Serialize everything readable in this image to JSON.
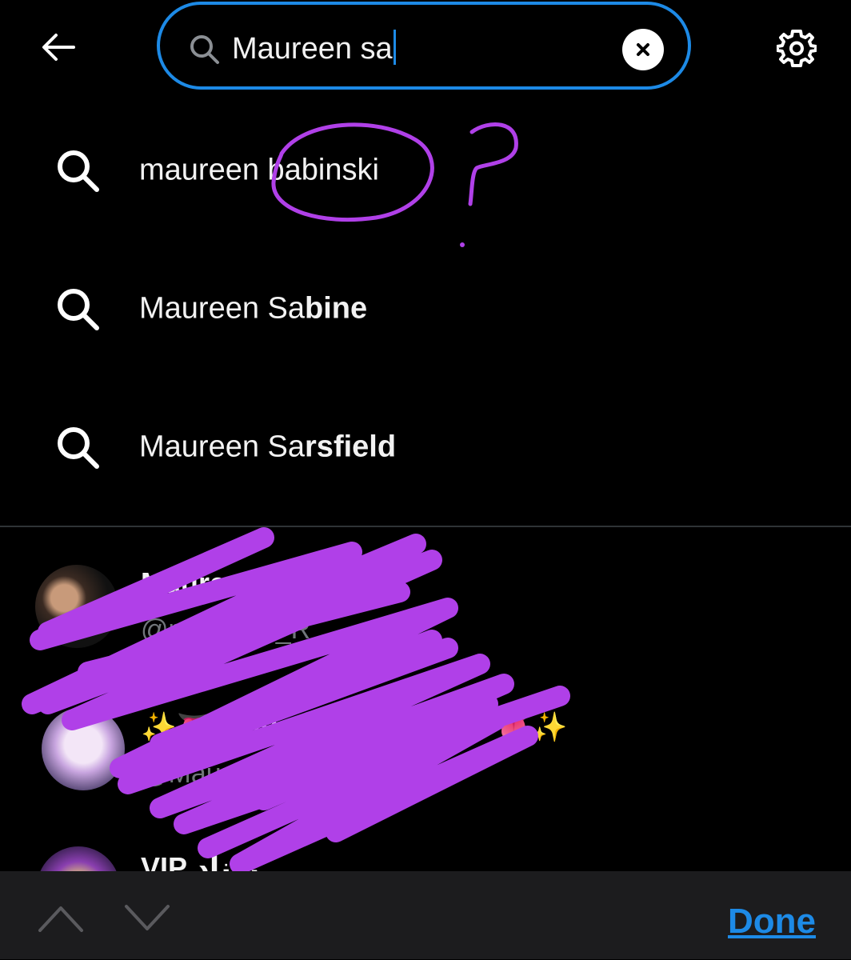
{
  "search": {
    "query": "Maureen sa"
  },
  "suggestions": [
    {
      "prefix": "maureen babinski",
      "rest": ""
    },
    {
      "prefix": "Maureen Sa",
      "rest": "bine"
    },
    {
      "prefix": "Maureen Sa",
      "rest": "rsfield"
    }
  ],
  "users": [
    {
      "name": "Maureen Ro…",
      "handle": "@maureen_R"
    },
    {
      "name": "✨👅 Maureen San Diego 👅✨",
      "handle": "@MaureenSanDiego"
    },
    {
      "name": "VIP ريناد",
      "handle": ""
    }
  ],
  "bottom_bar": {
    "done_label": "Done"
  },
  "colors": {
    "accent": "#1d8ae6",
    "annotation": "#b040e8",
    "background": "#000000"
  },
  "icons": [
    "back-arrow-icon",
    "search-icon",
    "clear-icon",
    "gear-icon",
    "chevron-up-icon",
    "chevron-down-icon"
  ]
}
